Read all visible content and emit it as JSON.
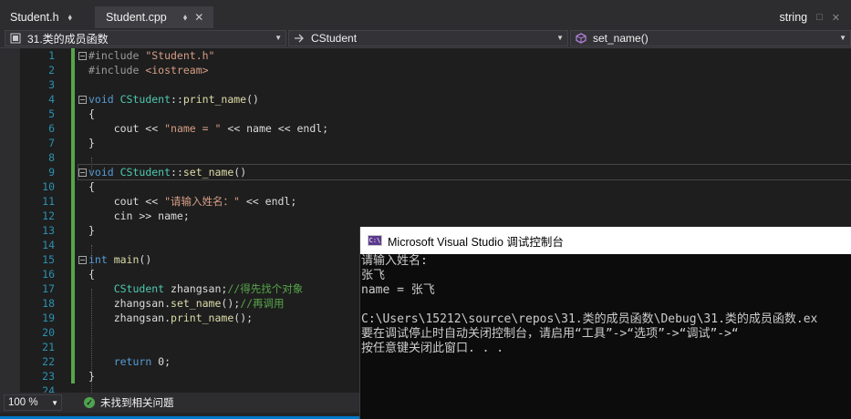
{
  "tabs": [
    {
      "label": "Student.h",
      "pin": "⬧"
    },
    {
      "label": "Student.cpp",
      "pin": "⬧",
      "close": "✕"
    }
  ],
  "tabbar_right": {
    "label": "string",
    "pin": "□",
    "close": "✕"
  },
  "nav": {
    "project": "31.类的成员函数",
    "scope": "CStudent",
    "member": "set_name()"
  },
  "line_numbers": [
    "1",
    "2",
    "3",
    "4",
    "5",
    "6",
    "7",
    "8",
    "9",
    "10",
    "11",
    "12",
    "13",
    "14",
    "15",
    "16",
    "17",
    "18",
    "19",
    "20",
    "21",
    "22",
    "23",
    "24"
  ],
  "code": {
    "l1a": "#include ",
    "l1b": "\"Student.h\"",
    "l2a": "#include ",
    "l2b": "<iostream>",
    "l4kw": "void ",
    "l4cls": "CStudent",
    "l4op": "::",
    "l4fn": "print_name",
    "l4rest": "()",
    "l5": "{",
    "l6a": "    cout << ",
    "l6b": "\"name = \"",
    "l6c": " << name << endl;",
    "l7": "}",
    "l9kw": "void ",
    "l9cls": "CStudent",
    "l9op": "::",
    "l9fn": "set_name",
    "l9rest": "()",
    "l10": "{",
    "l11a": "    cout << ",
    "l11b": "\"请输入姓名：\"",
    "l11c": " << endl;",
    "l12": "    cin >> name;",
    "l13": "}",
    "l15kw": "int ",
    "l15fn": "main",
    "l15rest": "()",
    "l16": "{",
    "l17a": "    ",
    "l17cls": "CStudent",
    "l17b": " zhangsan;",
    "l17cmt": "//得先找个对象",
    "l18a": "    zhangsan.",
    "l18fn": "set_name",
    "l18b": "();",
    "l18cmt": "//再调用",
    "l19a": "    zhangsan.",
    "l19fn": "print_name",
    "l19b": "();",
    "l22a": "    ",
    "l22kw": "return",
    "l22b": " 0;",
    "l23": "}"
  },
  "status": {
    "zoom": "100 %",
    "issues": "未找到相关问题"
  },
  "console": {
    "icon_text": "C:\\",
    "title": "Microsoft Visual Studio 调试控制台",
    "lines": [
      "请输入姓名:",
      "张飞",
      "name = 张飞",
      "",
      "C:\\Users\\15212\\source\\repos\\31.类的成员函数\\Debug\\31.类的成员函数.ex",
      "要在调试停止时自动关闭控制台，请启用“工具”->“选项”->“调试”->“",
      "按任意键关闭此窗口. . ."
    ]
  },
  "colors": {
    "keyword": "#569cd6",
    "class": "#4ec9b0",
    "function": "#dcdcaa",
    "string": "#d69d85",
    "comment": "#57a64a",
    "line_number": "#2b91af",
    "accent": "#007acc"
  }
}
